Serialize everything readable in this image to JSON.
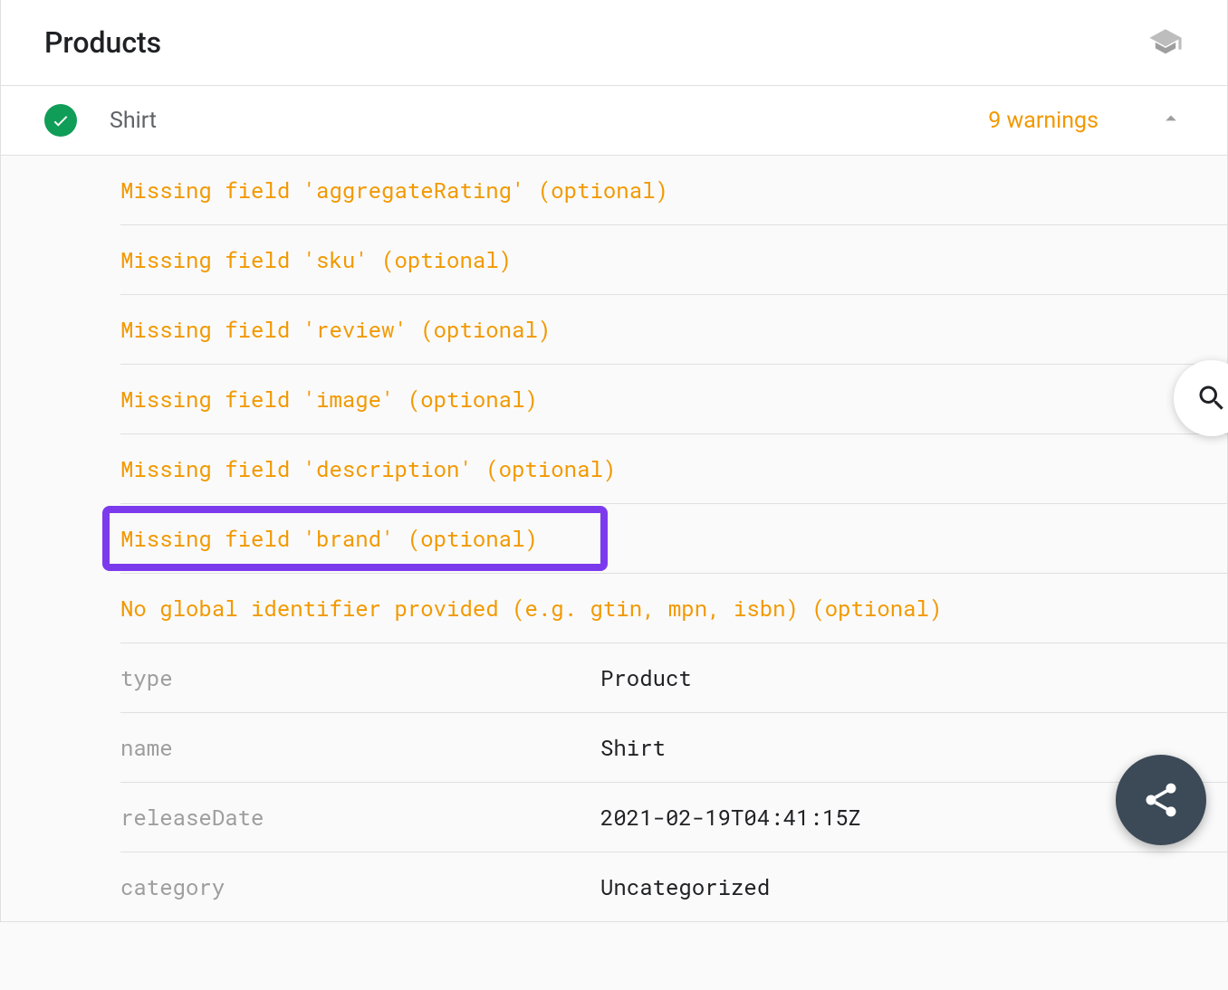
{
  "header": {
    "title": "Products"
  },
  "item": {
    "name": "Shirt",
    "warnings_label": "9 warnings"
  },
  "warnings": [
    "Missing field 'aggregateRating' (optional)",
    "Missing field 'sku' (optional)",
    "Missing field 'review' (optional)",
    "Missing field 'image' (optional)",
    "Missing field 'description' (optional)",
    "Missing field 'brand' (optional)",
    "No global identifier provided (e.g. gtin, mpn, isbn) (optional)"
  ],
  "highlighted_index": 5,
  "properties": [
    {
      "key": "type",
      "value": "Product"
    },
    {
      "key": "name",
      "value": "Shirt"
    },
    {
      "key": "releaseDate",
      "value": "2021-02-19T04:41:15Z"
    },
    {
      "key": "category",
      "value": "Uncategorized"
    }
  ]
}
